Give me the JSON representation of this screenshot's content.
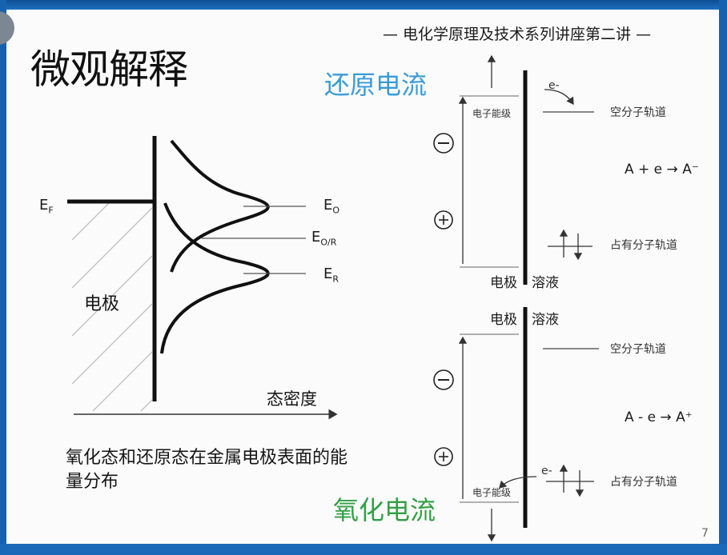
{
  "slide": {
    "title": "微观解释",
    "series": "— 电化学原理及技术系列讲座第二讲 —",
    "page_number": "7"
  },
  "left_figure": {
    "fermi_label": "E",
    "fermi_sub": "F",
    "eo_label": "E",
    "eo_sub": "O",
    "eor_label": "E",
    "eor_sub": "O/R",
    "er_label": "E",
    "er_sub": "R",
    "electrode_label": "电极",
    "axis_label": "态密度",
    "caption": "氧化态和还原态在金属电极表面的能量分布"
  },
  "reduction": {
    "heading": "还原电流",
    "electron": "e-",
    "fermi_level": "电子能级",
    "empty_orbital": "空分子轨道",
    "equation": "A + e → A⁻",
    "occupied_orbital": "占有分子轨道",
    "electrode": "电极",
    "solution": "溶液",
    "minus": "−",
    "plus": "+"
  },
  "oxidation": {
    "heading": "氧化电流",
    "electrode": "电极",
    "solution": "溶液",
    "empty_orbital": "空分子轨道",
    "equation": "A - e → A⁺",
    "electron": "e-",
    "occupied_orbital": "占有分子轨道",
    "fermi_level": "电子能级",
    "minus": "−",
    "plus": "+"
  }
}
